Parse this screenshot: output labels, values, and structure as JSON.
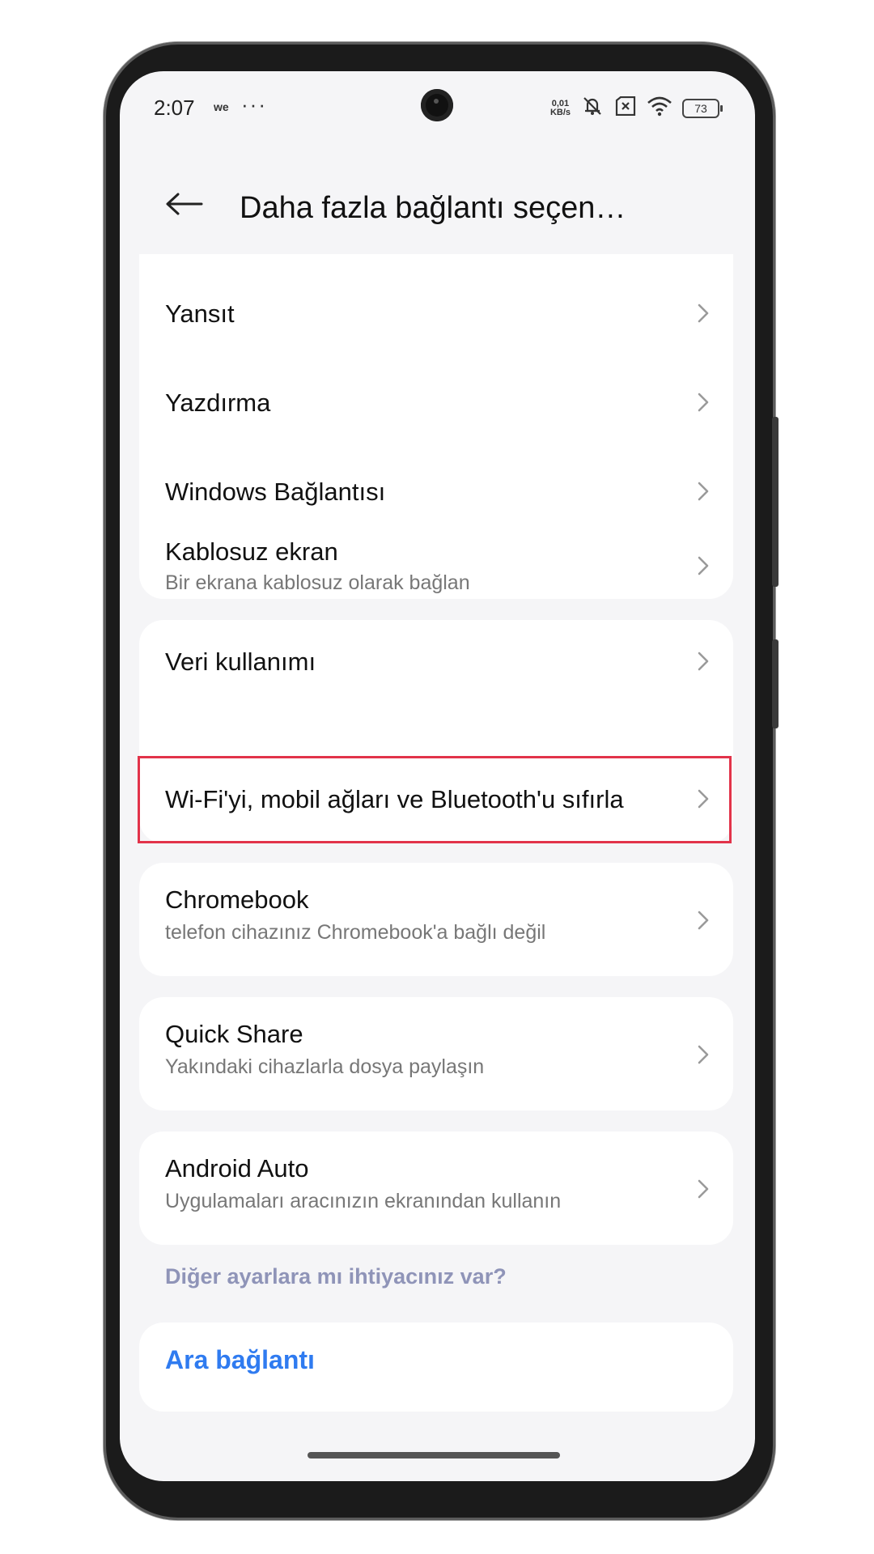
{
  "status_bar": {
    "time": "2:07",
    "carrier_glyph": "we",
    "more_dots": "···",
    "net_speed_top": "0,01",
    "net_speed_bottom": "KB/s",
    "battery": "73",
    "icons": [
      "mute-icon",
      "sim-x-icon",
      "wifi-icon",
      "battery-icon"
    ]
  },
  "header": {
    "title": "Daha fazla bağlantı seçen…",
    "back_icon": "back-arrow-icon"
  },
  "group1": {
    "items": [
      {
        "label": "Yansıt"
      },
      {
        "label": "Yazdırma"
      },
      {
        "label": "Windows Bağlantısı"
      },
      {
        "label": "Kablosuz ekran",
        "sub": "Bir ekrana kablosuz olarak bağlan"
      }
    ]
  },
  "group2": {
    "items": [
      {
        "label": "Veri kullanımı"
      },
      {
        "label": "Wi-Fi'yi, mobil ağları ve Bluetooth'u sıfırla",
        "highlighted": true
      }
    ]
  },
  "chromebook": {
    "label": "Chromebook",
    "sub": "telefon cihazınız Chromebook'a bağlı değil"
  },
  "quick_share": {
    "label": "Quick Share",
    "sub": "Yakındaki cihazlarla dosya paylaşın"
  },
  "android_auto": {
    "label": "Android Auto",
    "sub": "Uygulamaları aracınızın ekranından kullanın"
  },
  "more_settings": {
    "prompt": "Diğer ayarlara mı ihtiyacınız var?",
    "link": "Ara bağlantı"
  },
  "colors": {
    "highlight_border": "#e2334a",
    "link": "#2f7bf0",
    "section_label": "#8f94b8",
    "background": "#f5f5f7"
  }
}
